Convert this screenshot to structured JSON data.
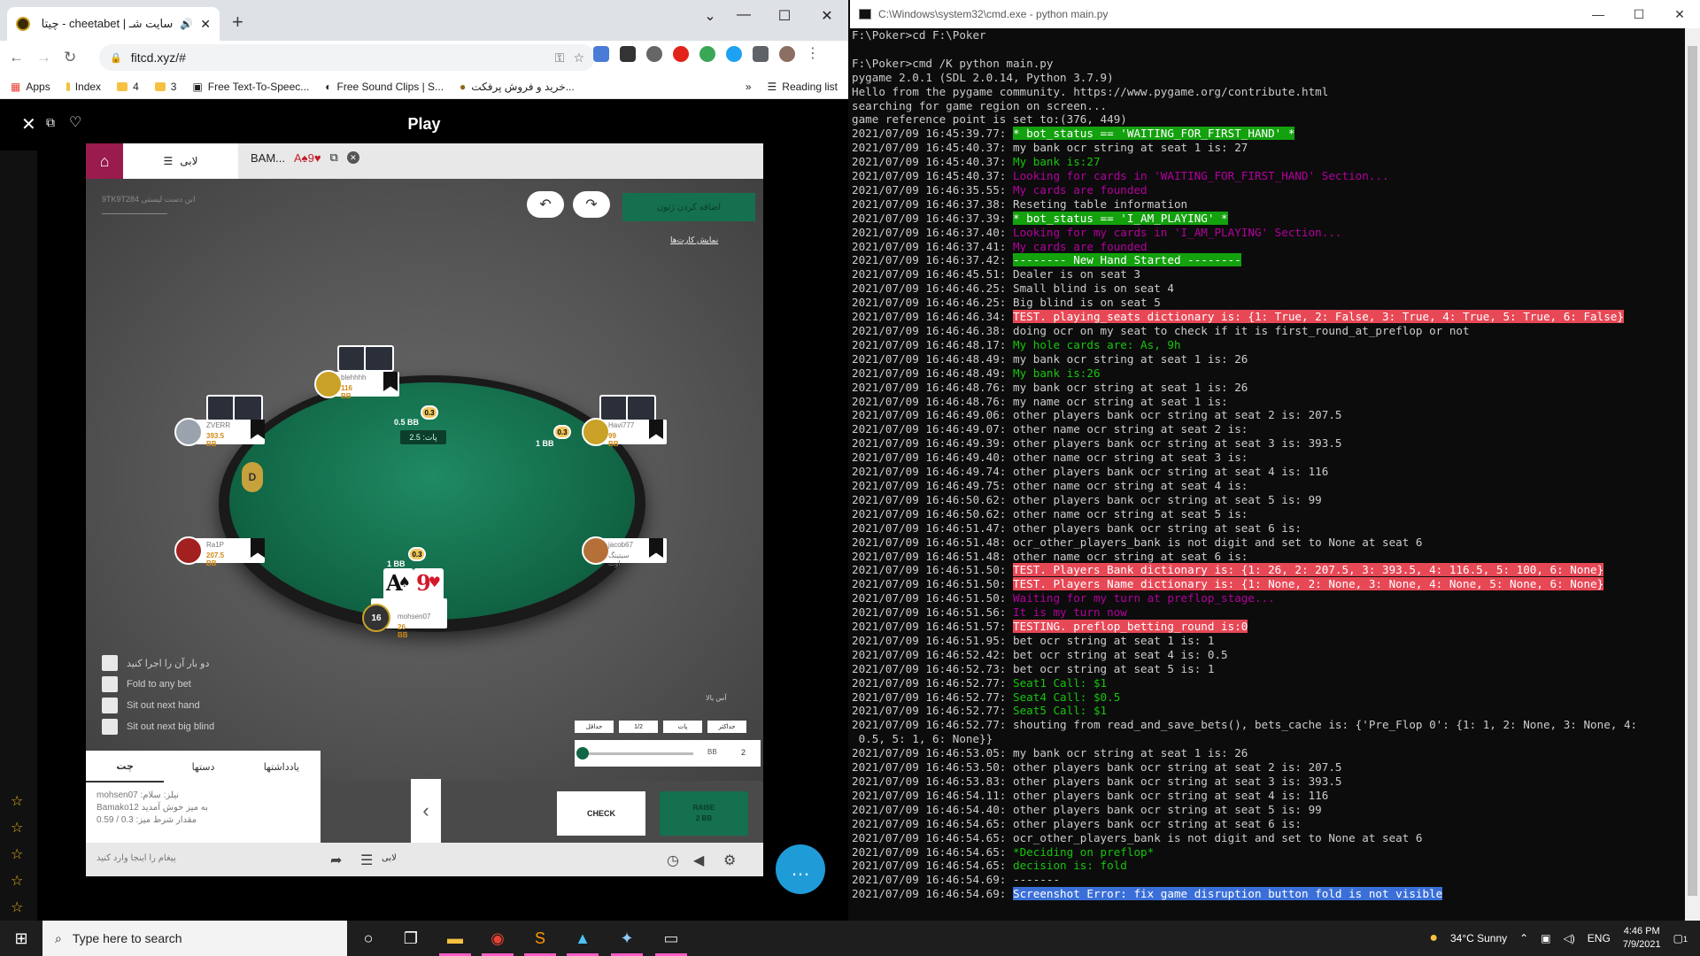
{
  "browser": {
    "tab_title": "سایت شـ | cheetabet - چیتا بت",
    "url": "fitcd.xyz/#",
    "bookmarks": [
      "Apps",
      "Index",
      "4",
      "3",
      "Free Text-To-Speec...",
      "Free Sound Clips | S...",
      "خرید و فروش پرفکت...",
      "Reading list"
    ],
    "more": "»"
  },
  "game": {
    "page_title": "Play",
    "tab_lobby": "لابی",
    "tab_table": "BAM...",
    "tab_cards": "A♠9♥",
    "top_info_line1": "9TK9T284 ابن دست لیستی",
    "top_info_line2": "",
    "lobby_button": "اضافه کردن ژتون",
    "show_cards": "نمایش کارت‌ها",
    "pot": "پات: 2.5",
    "dealer": "D",
    "seats": [
      {
        "name": "ZVERR",
        "stack": "393.5 BB"
      },
      {
        "name": "blehhhh",
        "stack": "116 BB"
      },
      {
        "name": "Havi777",
        "stack": "99 BB"
      },
      {
        "name": "Ra1P",
        "stack": "207.5 BB"
      },
      {
        "name": "jacob67",
        "stack": "سیتینگ اوت"
      },
      {
        "name": "mohsen07",
        "stack": "26 BB",
        "level": "16"
      }
    ],
    "bets": {
      "top_chip": "0.3",
      "top_label": "0.5 BB",
      "right_chip": "0.3",
      "right_label": "1 BB",
      "hero_chip": "0.3",
      "hero_label": "1 BB"
    },
    "hero_cards": [
      {
        "rank": "A",
        "suit": "♠",
        "color": "#111111"
      },
      {
        "rank": "9",
        "suit": "♥",
        "color": "#d3182a"
      }
    ],
    "checkboxes": [
      "دو بار آن را اجرا کنید",
      "Fold to any bet",
      "Sit out next hand",
      "Sit out next big blind"
    ],
    "side_note": "آس بالا",
    "bet_presets": [
      "حداقل",
      "1/2",
      "پات",
      "حداکثر"
    ],
    "slider_unit": "BB",
    "slider_value": "2",
    "slider_fraction": 0,
    "chat_tabs": [
      "چت",
      "دستها",
      "یادداشتها"
    ],
    "chat_messages": [
      "mohsen07 :نیلز: سلام",
      "Bamako12 به میز خوش آمدید",
      "مقدار شرط میز: 0.3 / 0.59"
    ],
    "check_button": "CHECK",
    "raise_button": "RAISE",
    "raise_amount": "2 BB",
    "chat_placeholder": "پیغام را اینجا وارد کنید",
    "bottom_lobby": "لابی"
  },
  "cmd": {
    "title": "C:\\Windows\\system32\\cmd.exe - python  main.py",
    "lines": [
      {
        "t": "F:\\Poker>cd F:\\Poker"
      },
      {
        "t": ""
      },
      {
        "t": "F:\\Poker>cmd /K python main.py"
      },
      {
        "t": "pygame 2.0.1 (SDL 2.0.14, Python 3.7.9)"
      },
      {
        "t": "Hello from the pygame community. https://www.pygame.org/contribute.html"
      },
      {
        "t": "searching for game region on screen..."
      },
      {
        "t": "game reference point is set to:(376, 449)"
      },
      {
        "p": "2021/07/09 16:45:39.77: ",
        "t": "* bot_status == 'WAITING_FOR_FIRST_HAND' *",
        "s": "hl-green"
      },
      {
        "p": "2021/07/09 16:45:40.37: ",
        "t": "my bank ocr string at seat 1 is: 27"
      },
      {
        "p": "2021/07/09 16:45:40.37: ",
        "t": "My bank is:27",
        "s": "t-green"
      },
      {
        "p": "2021/07/09 16:45:40.37: ",
        "t": "Looking for cards in 'WAITING_FOR_FIRST_HAND' Section...",
        "s": "t-mag"
      },
      {
        "p": "2021/07/09 16:46:35.55: ",
        "t": "My cards are founded",
        "s": "t-mag"
      },
      {
        "p": "2021/07/09 16:46:37.38: ",
        "t": "Reseting table information"
      },
      {
        "p": "2021/07/09 16:46:37.39: ",
        "t": "* bot_status == 'I_AM_PLAYING' *",
        "s": "hl-green"
      },
      {
        "p": "2021/07/09 16:46:37.40: ",
        "t": "Looking for my cards in 'I_AM_PLAYING' Section...",
        "s": "t-mag"
      },
      {
        "p": "2021/07/09 16:46:37.41: ",
        "t": "My cards are founded",
        "s": "t-mag"
      },
      {
        "p": "2021/07/09 16:46:37.42: ",
        "t": "-------- New Hand Started --------",
        "s": "hl-green"
      },
      {
        "p": "2021/07/09 16:46:45.51: ",
        "t": "Dealer is on seat 3"
      },
      {
        "p": "2021/07/09 16:46:46.25: ",
        "t": "Small blind is on seat 4"
      },
      {
        "p": "2021/07/09 16:46:46.25: ",
        "t": "Big blind is on seat 5"
      },
      {
        "p": "2021/07/09 16:46:46.34: ",
        "t": "TEST. playing_seats dictionary is: {1: True, 2: False, 3: True, 4: True, 5: True, 6: False}",
        "s": "hl-red"
      },
      {
        "p": "2021/07/09 16:46:46.38: ",
        "t": "doing ocr on my seat to check if it is first_round_at_preflop or not"
      },
      {
        "p": "2021/07/09 16:46:48.17: ",
        "t": "My hole cards are: As, 9h",
        "s": "t-green"
      },
      {
        "p": "2021/07/09 16:46:48.49: ",
        "t": "my bank ocr string at seat 1 is: 26"
      },
      {
        "p": "2021/07/09 16:46:48.49: ",
        "t": "My bank is:26",
        "s": "t-green"
      },
      {
        "p": "2021/07/09 16:46:48.76: ",
        "t": "my bank ocr string at seat 1 is: 26"
      },
      {
        "p": "2021/07/09 16:46:48.76: ",
        "t": "my name ocr string at seat 1 is:"
      },
      {
        "p": "2021/07/09 16:46:49.06: ",
        "t": "other players bank ocr string at seat 2 is: 207.5"
      },
      {
        "p": "2021/07/09 16:46:49.07: ",
        "t": "other name ocr string at seat 2 is:"
      },
      {
        "p": "2021/07/09 16:46:49.39: ",
        "t": "other players bank ocr string at seat 3 is: 393.5"
      },
      {
        "p": "2021/07/09 16:46:49.40: ",
        "t": "other name ocr string at seat 3 is:"
      },
      {
        "p": "2021/07/09 16:46:49.74: ",
        "t": "other players bank ocr string at seat 4 is: 116"
      },
      {
        "p": "2021/07/09 16:46:49.75: ",
        "t": "other name ocr string at seat 4 is:"
      },
      {
        "p": "2021/07/09 16:46:50.62: ",
        "t": "other players bank ocr string at seat 5 is: 99"
      },
      {
        "p": "2021/07/09 16:46:50.62: ",
        "t": "other name ocr string at seat 5 is:"
      },
      {
        "p": "2021/07/09 16:46:51.47: ",
        "t": "other players bank ocr string at seat 6 is:"
      },
      {
        "p": "2021/07/09 16:46:51.48: ",
        "t": "ocr_other_players_bank is not digit and set to None at seat 6"
      },
      {
        "p": "2021/07/09 16:46:51.48: ",
        "t": "other name ocr string at seat 6 is:"
      },
      {
        "p": "2021/07/09 16:46:51.50: ",
        "t": "TEST. Players Bank dictionary is: {1: 26, 2: 207.5, 3: 393.5, 4: 116.5, 5: 100, 6: None}",
        "s": "hl-red"
      },
      {
        "p": "2021/07/09 16:46:51.50: ",
        "t": "TEST. Players Name dictionary is: {1: None, 2: None, 3: None, 4: None, 5: None, 6: None}",
        "s": "hl-red"
      },
      {
        "p": "2021/07/09 16:46:51.50: ",
        "t": "Waiting for my turn at preflop_stage...",
        "s": "t-mag"
      },
      {
        "p": "2021/07/09 16:46:51.56: ",
        "t": "It is my turn now",
        "s": "t-mag"
      },
      {
        "p": "2021/07/09 16:46:51.57: ",
        "t": "TESTING. preflop_betting_round is:0",
        "s": "hl-red"
      },
      {
        "p": "2021/07/09 16:46:51.95: ",
        "t": "bet ocr string at seat 1 is: 1"
      },
      {
        "p": "2021/07/09 16:46:52.42: ",
        "t": "bet ocr string at seat 4 is: 0.5"
      },
      {
        "p": "2021/07/09 16:46:52.73: ",
        "t": "bet ocr string at seat 5 is: 1"
      },
      {
        "p": "2021/07/09 16:46:52.77: ",
        "t": "Seat1 Call: $1",
        "s": "t-green"
      },
      {
        "p": "2021/07/09 16:46:52.77: ",
        "t": "Seat4 Call: $0.5",
        "s": "t-green"
      },
      {
        "p": "2021/07/09 16:46:52.77: ",
        "t": "Seat5 Call: $1",
        "s": "t-green"
      },
      {
        "p": "2021/07/09 16:46:52.77: ",
        "t": "shouting from read_and_save_bets(), bets_cache is: {'Pre_Flop 0': {1: 1, 2: None, 3: None, 4:"
      },
      {
        "t": " 0.5, 5: 1, 6: None}}"
      },
      {
        "p": "2021/07/09 16:46:53.05: ",
        "t": "my bank ocr string at seat 1 is: 26"
      },
      {
        "p": "2021/07/09 16:46:53.50: ",
        "t": "other players bank ocr string at seat 2 is: 207.5"
      },
      {
        "p": "2021/07/09 16:46:53.83: ",
        "t": "other players bank ocr string at seat 3 is: 393.5"
      },
      {
        "p": "2021/07/09 16:46:54.11: ",
        "t": "other players bank ocr string at seat 4 is: 116"
      },
      {
        "p": "2021/07/09 16:46:54.40: ",
        "t": "other players bank ocr string at seat 5 is: 99"
      },
      {
        "p": "2021/07/09 16:46:54.65: ",
        "t": "other players bank ocr string at seat 6 is:"
      },
      {
        "p": "2021/07/09 16:46:54.65: ",
        "t": "ocr_other_players_bank is not digit and set to None at seat 6"
      },
      {
        "p": "2021/07/09 16:46:54.65: ",
        "t": "*Deciding on preflop*",
        "s": "t-green"
      },
      {
        "p": "2021/07/09 16:46:54.65: ",
        "t": "decision is: fold",
        "s": "t-green"
      },
      {
        "p": "2021/07/09 16:46:54.69: ",
        "t": "-------"
      },
      {
        "p": "2021/07/09 16:46:54.69: ",
        "t": "Screenshot Error: fix game disruption button fold is not visible",
        "s": "hl-blue"
      }
    ]
  },
  "taskbar": {
    "search_placeholder": "Type here to search",
    "weather": "34°C  Sunny",
    "lang": "ENG",
    "time": "4:46 PM",
    "date": "7/9/2021",
    "notifications": "1"
  }
}
